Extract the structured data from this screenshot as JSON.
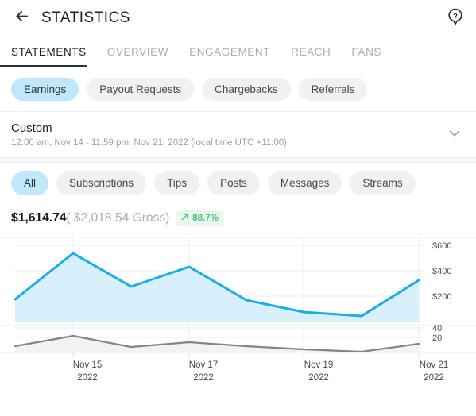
{
  "header": {
    "title": "STATISTICS",
    "back_icon": "arrow-left-icon",
    "help_icon": "help-question-icon"
  },
  "tabs": [
    {
      "label": "STATEMENTS",
      "active": true
    },
    {
      "label": "OVERVIEW",
      "active": false
    },
    {
      "label": "ENGAGEMENT",
      "active": false
    },
    {
      "label": "REACH",
      "active": false
    },
    {
      "label": "FANS",
      "active": false
    }
  ],
  "primary_chips": [
    {
      "label": "Earnings",
      "selected": true
    },
    {
      "label": "Payout Requests",
      "selected": false
    },
    {
      "label": "Chargebacks",
      "selected": false
    },
    {
      "label": "Referrals",
      "selected": false
    }
  ],
  "date_range": {
    "title": "Custom",
    "subtitle": "12:00 am, Nov 14 - 11:59 pm, Nov 21, 2022 (local time UTC +11:00)",
    "chevron_icon": "chevron-down-icon"
  },
  "category_chips": [
    {
      "label": "All",
      "selected": true
    },
    {
      "label": "Subscriptions",
      "selected": false
    },
    {
      "label": "Tips",
      "selected": false
    },
    {
      "label": "Posts",
      "selected": false
    },
    {
      "label": "Messages",
      "selected": false
    },
    {
      "label": "Streams",
      "selected": false
    }
  ],
  "summary": {
    "net": "$1,614.74",
    "gross": "( $2,018.54 Gross)",
    "trend_icon": "arrow-up-right-icon",
    "trend": "88.7%"
  },
  "colors": {
    "accent_blue": "#19AEE8",
    "area_blue": "#D8F0FB",
    "selected_chip": "#BFE8FA",
    "chip_bg": "#F0F1F3",
    "secondary_line": "#7D8791",
    "secondary_area": "#F1F2F3",
    "grid": "#E9EBED",
    "trend_green": "#4CBF78",
    "trend_bg": "#E8F8EE",
    "text_dark": "#1D2226",
    "text_muted": "#A7AEB5"
  },
  "chart_data": [
    {
      "type": "area",
      "name": "earnings",
      "title": "",
      "xlabel": "",
      "ylabel": "",
      "x": [
        "Nov 14",
        "Nov 15",
        "Nov 16",
        "Nov 17",
        "Nov 18",
        "Nov 19",
        "Nov 20",
        "Nov 21"
      ],
      "values": [
        185,
        540,
        275,
        430,
        170,
        75,
        45,
        325
      ],
      "ytick_labels": [
        "$600",
        "$400",
        "$200"
      ],
      "ytick_values": [
        600,
        400,
        200
      ],
      "ylim": [
        0,
        700
      ],
      "xtick_labels": [
        "Nov 15\n2022",
        "Nov 17\n2022",
        "Nov 19\n2022",
        "Nov 21\n2022"
      ],
      "grid": true,
      "legend": "none",
      "line_color": "#19AEE8",
      "fill_color": "#D8F0FB"
    },
    {
      "type": "area",
      "name": "transactions",
      "title": "",
      "xlabel": "",
      "ylabel": "",
      "x": [
        "Nov 14",
        "Nov 15",
        "Nov 16",
        "Nov 17",
        "Nov 18",
        "Nov 19",
        "Nov 20",
        "Nov 21"
      ],
      "values": [
        19,
        38,
        18,
        24,
        18,
        12,
        8,
        22
      ],
      "ytick_labels": [
        "40",
        "20"
      ],
      "ytick_values": [
        40,
        20
      ],
      "ylim": [
        0,
        50
      ],
      "grid": true,
      "legend": "none",
      "line_color": "#7D8791",
      "fill_color": "#F1F2F3"
    }
  ],
  "x_axis_labels": [
    {
      "day": "Nov 15",
      "year": "2022"
    },
    {
      "day": "Nov 17",
      "year": "2022"
    },
    {
      "day": "Nov 19",
      "year": "2022"
    },
    {
      "day": "Nov 21",
      "year": "2022"
    }
  ]
}
